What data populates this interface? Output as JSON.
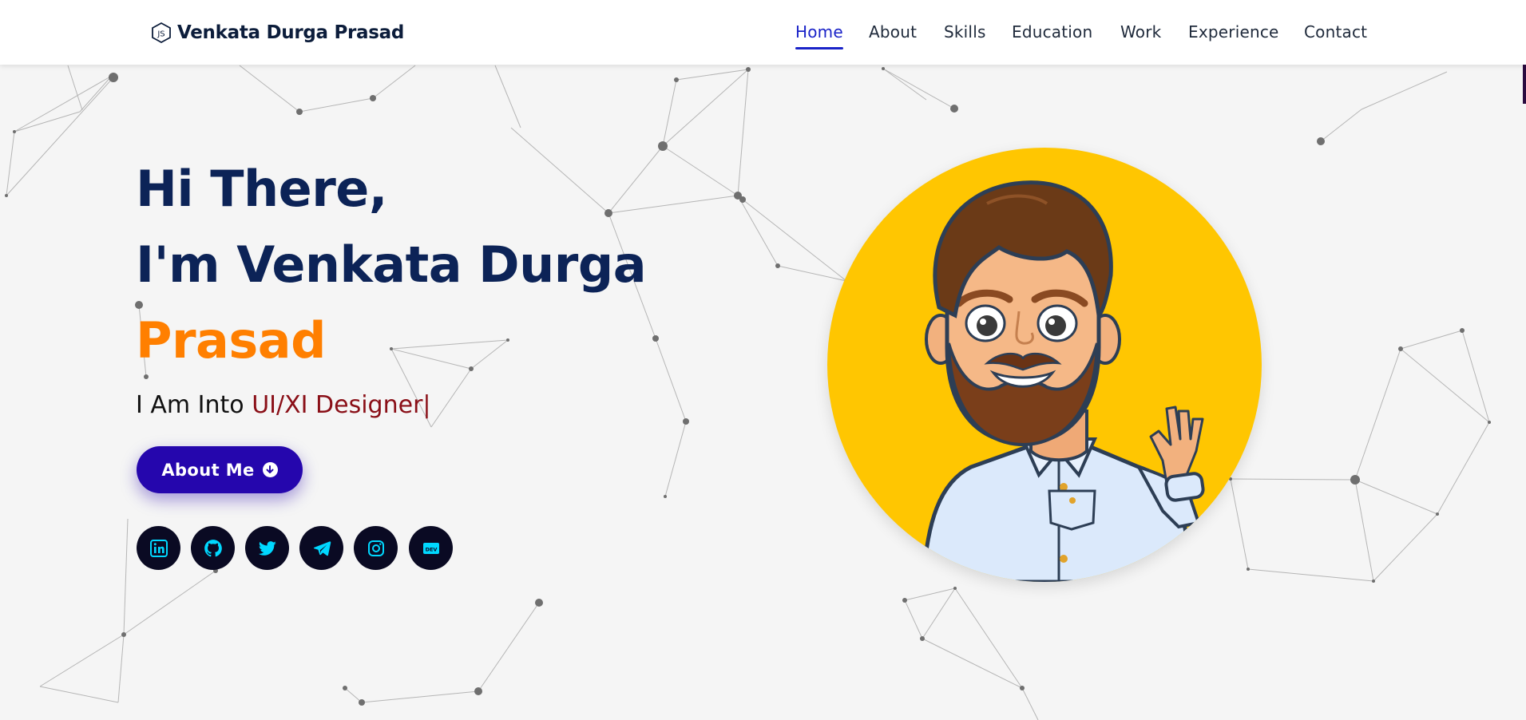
{
  "brand": {
    "logo_icon": "nodejs-hexagon-icon",
    "name": "Venkata Durga Prasad"
  },
  "nav": {
    "items": [
      {
        "label": "Home",
        "active": true
      },
      {
        "label": "About",
        "active": false
      },
      {
        "label": "Skills",
        "active": false
      },
      {
        "label": "Education",
        "active": false
      },
      {
        "label": "Work",
        "active": false
      },
      {
        "label": "Experience",
        "active": false
      },
      {
        "label": "Contact",
        "active": false
      }
    ]
  },
  "hero": {
    "greeting_1": "Hi There,",
    "greeting_2": "I'm Venkata Durga",
    "name_highlight": "Prasad",
    "into_prefix": "I Am Into ",
    "into_typed": "UI/XI Designer",
    "caret": "|",
    "about_button": "About Me",
    "about_button_icon": "arrow-circle-down-icon"
  },
  "social": [
    {
      "name": "linkedin-icon"
    },
    {
      "name": "github-icon"
    },
    {
      "name": "twitter-icon"
    },
    {
      "name": "telegram-icon"
    },
    {
      "name": "instagram-icon"
    },
    {
      "name": "dev-icon",
      "label": "DEV"
    }
  ],
  "colors": {
    "primary_dark": "#0c2357",
    "accent_orange": "#ff7f00",
    "typed_text": "#8a0f17",
    "button": "#2506ad",
    "nav_active": "#1a23c8",
    "social_bg": "#0a0a23",
    "social_icon": "#00d8ff",
    "avatar_bg": "#ffc601"
  },
  "avatar": {
    "description_icon": "cartoon-avatar-waving"
  }
}
